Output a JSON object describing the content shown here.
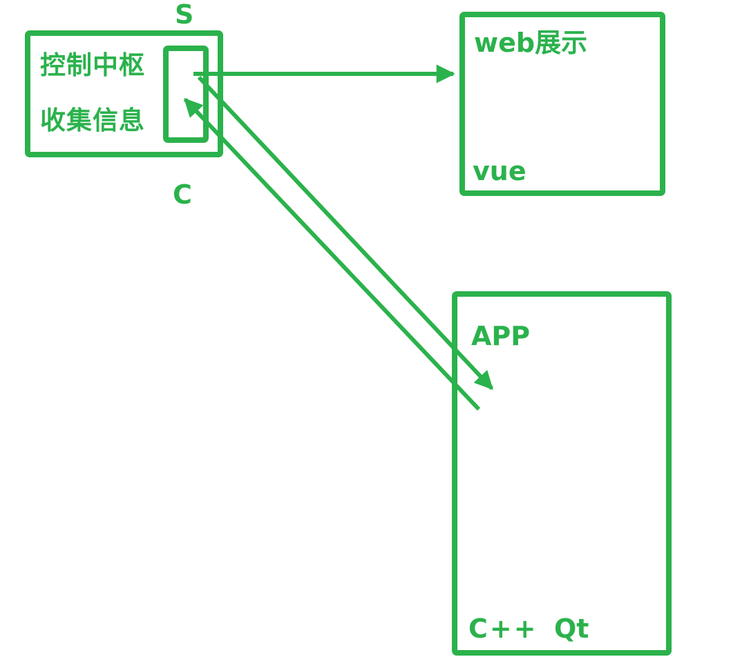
{
  "colors": {
    "accent": "#2bb24c",
    "background": "#ffffff"
  },
  "server_box": {
    "label_top": "S",
    "label_bottom": "C",
    "line1": "控制中枢",
    "line2": "收集信息"
  },
  "web_box": {
    "title": "web展示",
    "tech": "vue"
  },
  "app_box": {
    "title": "APP",
    "tech_lang": "C++",
    "tech_framework": "Qt"
  },
  "connections": [
    {
      "from": "server_box",
      "to": "web_box",
      "arrow": "to"
    },
    {
      "from": "server_box",
      "to": "app_box",
      "arrow": "to"
    },
    {
      "from": "app_box",
      "to": "server_box",
      "arrow": "to"
    }
  ]
}
